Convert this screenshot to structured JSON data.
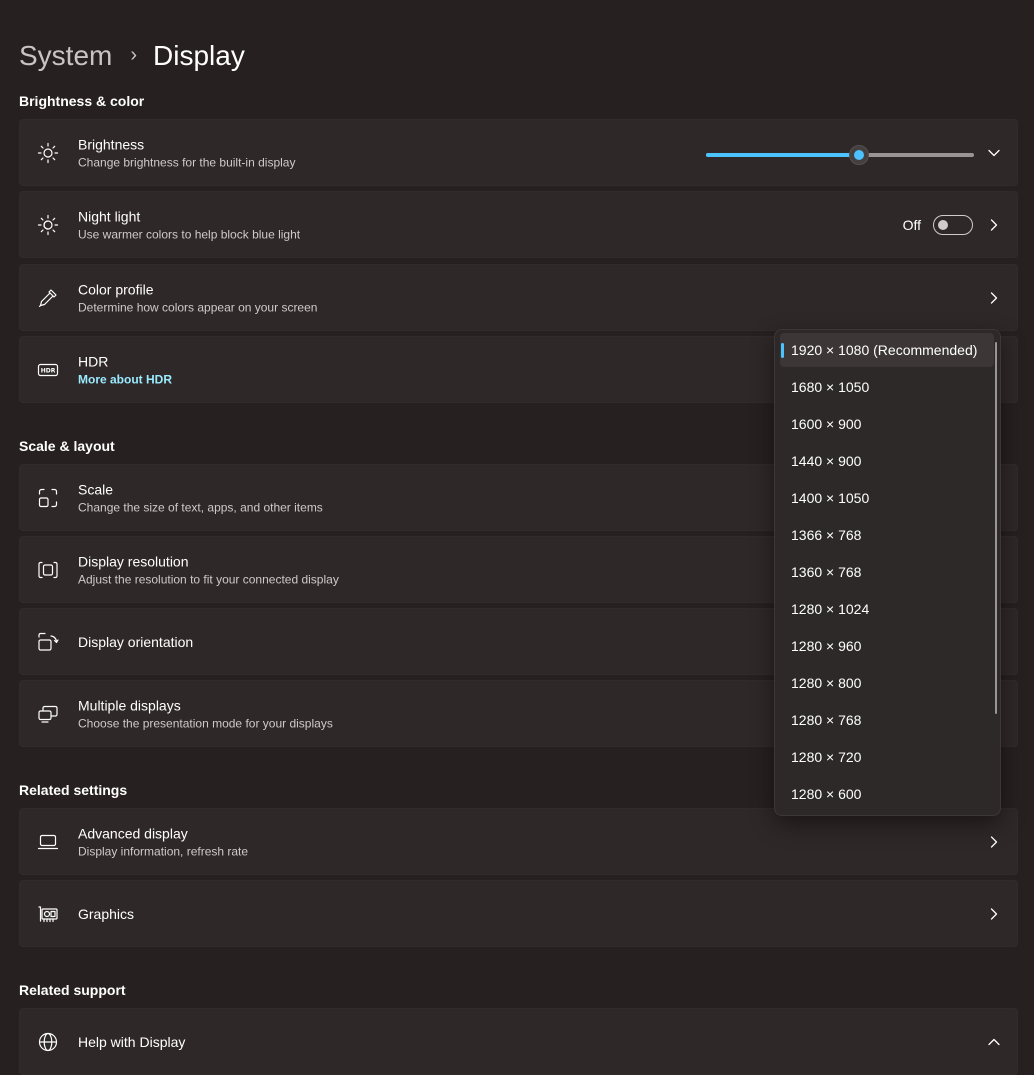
{
  "breadcrumb": {
    "parent": "System",
    "separator": "›",
    "current": "Display"
  },
  "sections": {
    "brightness_color": "Brightness & color",
    "scale_layout": "Scale & layout",
    "related_settings": "Related settings",
    "related_support": "Related support"
  },
  "brightness": {
    "title": "Brightness",
    "subtitle": "Change brightness for the built-in display",
    "level_percent": 57
  },
  "night_light": {
    "title": "Night light",
    "subtitle": "Use warmer colors to help block blue light",
    "state": "Off"
  },
  "color_profile": {
    "title": "Color profile",
    "subtitle": "Determine how colors appear on your screen"
  },
  "hdr": {
    "title": "HDR",
    "link": "More about HDR"
  },
  "scale": {
    "title": "Scale",
    "subtitle": "Change the size of text, apps, and other items"
  },
  "display_resolution": {
    "title": "Display resolution",
    "subtitle": "Adjust the resolution to fit your connected display"
  },
  "display_orientation": {
    "title": "Display orientation"
  },
  "multiple_displays": {
    "title": "Multiple displays",
    "subtitle": "Choose the presentation mode for your displays"
  },
  "advanced_display": {
    "title": "Advanced display",
    "subtitle": "Display information, refresh rate"
  },
  "graphics": {
    "title": "Graphics"
  },
  "help_display": {
    "title": "Help with Display"
  },
  "resolution_dropdown": {
    "selected_index": 0,
    "options": [
      "1920 × 1080 (Recommended)",
      "1680 × 1050",
      "1600 × 900",
      "1440 × 900",
      "1400 × 1050",
      "1366 × 768",
      "1360 × 768",
      "1280 × 1024",
      "1280 × 960",
      "1280 × 800",
      "1280 × 768",
      "1280 × 720",
      "1280 × 600"
    ]
  },
  "colors": {
    "accent": "#4cc2ff",
    "background": "#272020",
    "card": "#2f2828",
    "link": "#99ebff"
  }
}
